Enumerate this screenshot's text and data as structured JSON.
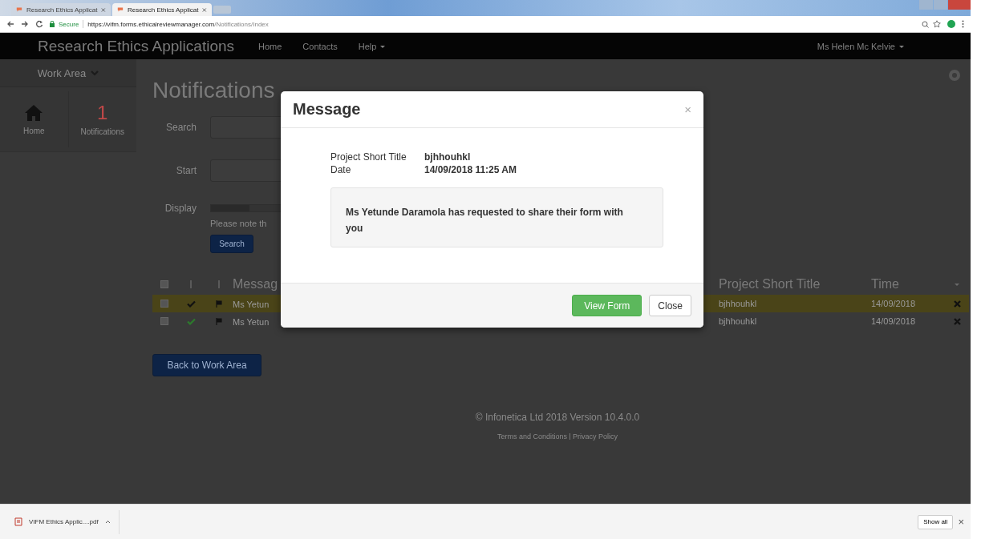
{
  "browser": {
    "tabs": [
      {
        "title": "Research Ethics Applicat",
        "selected": false
      },
      {
        "title": "Research Ethics Applicat",
        "selected": true
      }
    ],
    "secure_label": "Secure",
    "url_host": "https://vifm.forms.ethicalreviewmanager.com",
    "url_path": "/Notifications/Index"
  },
  "navbar": {
    "brand": "Research Ethics Applications",
    "links": [
      {
        "label": "Home",
        "dropdown": false
      },
      {
        "label": "Contacts",
        "dropdown": false
      },
      {
        "label": "Help",
        "dropdown": true
      }
    ],
    "user": "Ms Helen Mc Kelvie"
  },
  "sidebar": {
    "header": "Work Area",
    "tiles": [
      {
        "kind": "icon",
        "label": "Home"
      },
      {
        "kind": "count",
        "count": "1",
        "label": "Notifications"
      }
    ]
  },
  "page": {
    "title": "Notifications",
    "form": [
      {
        "kind": "text",
        "label": "Search"
      },
      {
        "kind": "text",
        "label": "Start"
      },
      {
        "kind": "slider",
        "label": "Display",
        "level": 0.12
      }
    ],
    "note": "Please note th",
    "search_button": "Search",
    "table": {
      "columns": [
        "Messag",
        "Project Short Title",
        "Time"
      ],
      "all_checked": false,
      "rows": [
        {
          "checked": false,
          "highlighted": true,
          "message": "Ms Yetun",
          "project": "bjhhouhkl",
          "time": "14/09/2018"
        },
        {
          "checked": false,
          "highlighted": false,
          "message": "Ms Yetun",
          "project": "bjhhouhkl",
          "time": "14/09/2018"
        }
      ]
    },
    "back_button": "Back to Work Area"
  },
  "footer": {
    "copyright": "© Infonetica Ltd 2018 Version 10.4.0.0",
    "links": [
      "Terms and Conditions",
      "Privacy Policy"
    ]
  },
  "modal": {
    "title": "Message",
    "close_glyph": "×",
    "fields": [
      {
        "label": "Project Short Title",
        "value": "bjhhouhkl"
      },
      {
        "label": "Date",
        "value": "14/09/2018 11:25 AM"
      }
    ],
    "message": "Ms Yetunde Daramola has requested to share their form with you",
    "buttons": [
      {
        "label": "View Form",
        "kind": "primary"
      },
      {
        "label": "Close",
        "kind": "default"
      }
    ]
  },
  "downloads": {
    "file": "VIFM Ethics Applic....pdf",
    "show_all": "Show all",
    "close_glyph": "×"
  }
}
